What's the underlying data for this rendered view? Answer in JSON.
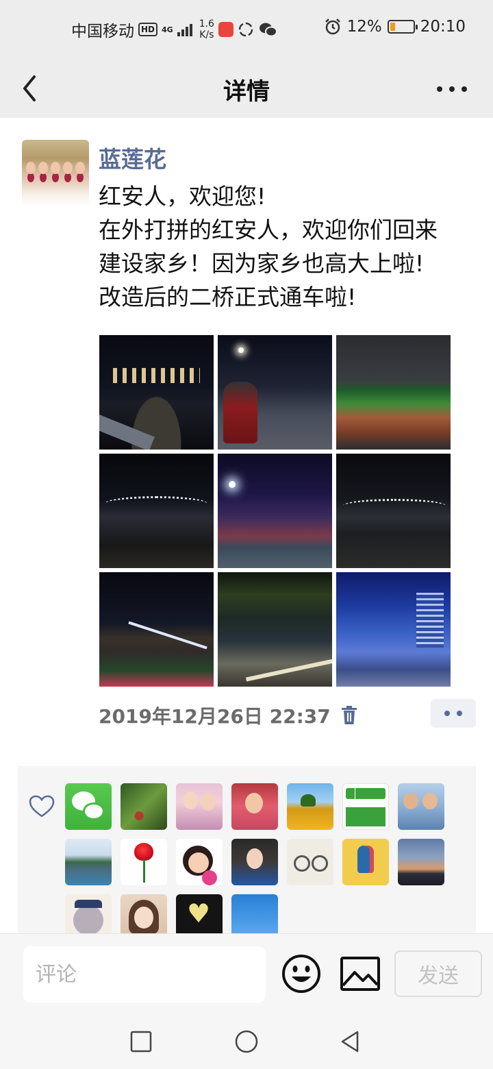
{
  "status_bar": {
    "carrier": "中国移动",
    "hd": "HD",
    "network": "4G",
    "speed_value": "1.6",
    "speed_unit": "K/s",
    "battery_percent": "12%",
    "battery_level": 0.12,
    "time": "20:10",
    "icons": [
      "signal-icon",
      "huawei-app-icon",
      "moments-icon",
      "wechat-icon",
      "alarm-icon",
      "battery-icon"
    ]
  },
  "nav": {
    "title": "详情",
    "back_icon": "chevron-left-icon",
    "more_icon": "more-horizontal-icon"
  },
  "post": {
    "author": "蓝莲花",
    "lines": [
      "红安人，欢迎您!",
      "在外打拼的红安人，欢迎你们回来",
      "建设家乡！因为家乡也高大上啦!",
      "改造后的二桥正式通车啦!"
    ],
    "photos": [
      "photo-1",
      "photo-2",
      "photo-3",
      "photo-4",
      "photo-5",
      "photo-6",
      "photo-7",
      "photo-8",
      "photo-9"
    ],
    "timestamp": "2019年12月26日 22:37",
    "delete_icon": "trash-icon",
    "more_icon": "more-dots-icon"
  },
  "likes": {
    "heart_icon": "heart-outline-icon",
    "count_shown": 18
  },
  "comment_bar": {
    "placeholder": "评论",
    "send_label": "发送",
    "emoji_icon": "emoji-icon",
    "image_icon": "image-icon"
  },
  "system_nav": {
    "icons": [
      "recent-apps-icon",
      "home-icon",
      "back-icon"
    ]
  },
  "colors": {
    "author": "#576b95",
    "bar_bg": "#ededed",
    "battery": "#f39a1e",
    "wechat_green": "#46b940"
  }
}
